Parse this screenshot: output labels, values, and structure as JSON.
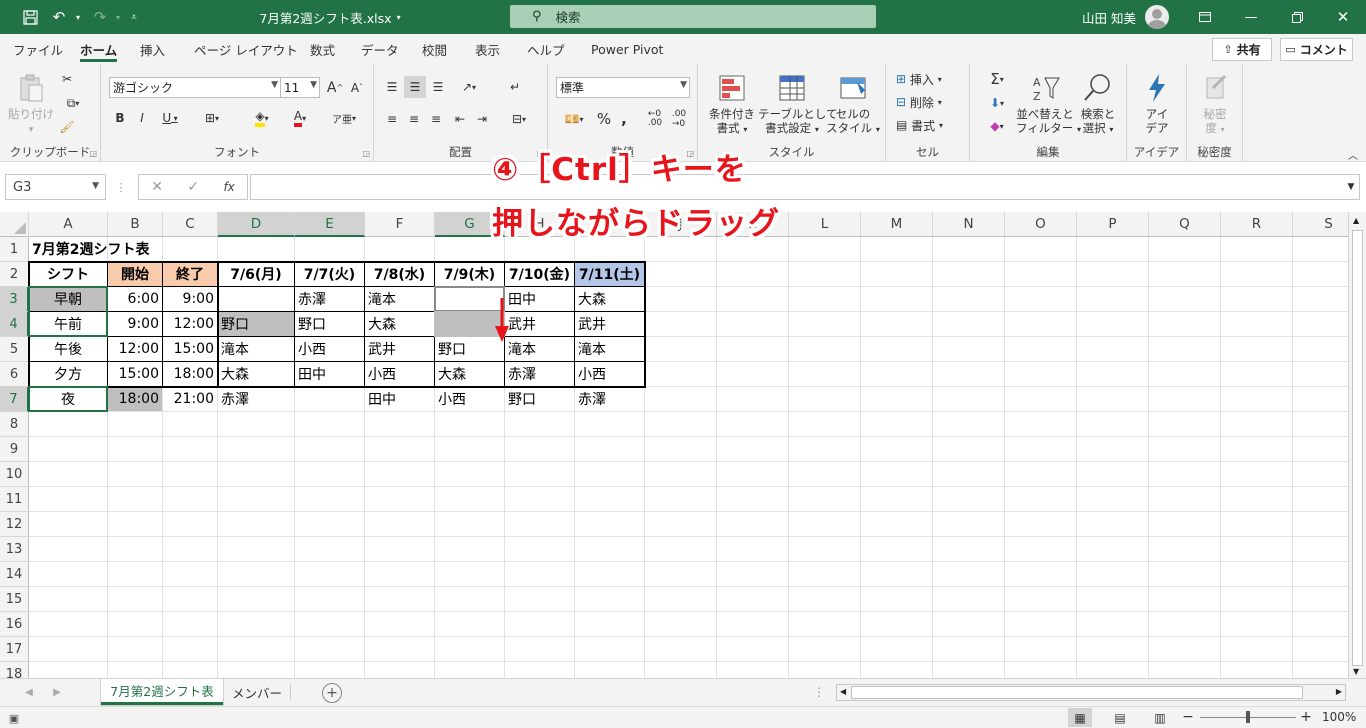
{
  "titlebar": {
    "filename": "7月第2週シフト表.xlsx",
    "search_placeholder": "検索",
    "user_name": "山田 知美",
    "icons": [
      "save-icon",
      "undo-icon",
      "redo-icon",
      "customize-icon",
      "ribbon-display-icon",
      "minimize-icon",
      "restore-icon",
      "close-icon"
    ]
  },
  "menu": {
    "tabs": [
      "ファイル",
      "ホーム",
      "挿入",
      "ページ レイアウト",
      "数式",
      "データ",
      "校閲",
      "表示",
      "ヘルプ",
      "Power Pivot"
    ],
    "active_tab": "ホーム",
    "share_label": "共有",
    "comment_label": "コメント"
  },
  "ribbon": {
    "clipboard": {
      "label": "クリップボード",
      "paste": "貼り付け"
    },
    "font": {
      "label": "フォント",
      "font_name": "游ゴシック",
      "font_size": "11"
    },
    "alignment": {
      "label": "配置"
    },
    "number": {
      "label": "数値",
      "format": "標準"
    },
    "styles": {
      "label": "スタイル",
      "cond1": "条件付き",
      "cond2": "書式",
      "table1": "テーブルとして",
      "table2": "書式設定",
      "cell1": "セルの",
      "cell2": "スタイル"
    },
    "cells": {
      "label": "セル",
      "insert": "挿入",
      "delete": "削除",
      "format": "書式"
    },
    "editing": {
      "label": "編集",
      "sort1": "並べ替えと",
      "sort2": "フィルター",
      "find1": "検索と",
      "find2": "選択"
    },
    "ideas": {
      "label": "アイデア",
      "b1": "アイ",
      "b2": "デア"
    },
    "sensitivity": {
      "label": "秘密度",
      "b1": "秘密",
      "b2": "度"
    }
  },
  "formula_bar": {
    "name_box": "G3",
    "fx": "fx",
    "formula": ""
  },
  "sheet": {
    "columns": [
      "A",
      "B",
      "C",
      "D",
      "E",
      "F",
      "G",
      "H",
      "I",
      "J",
      "K",
      "L",
      "M",
      "N",
      "O",
      "P",
      "Q",
      "R",
      "S"
    ],
    "rows": [
      "1",
      "2",
      "3",
      "4",
      "5",
      "6",
      "7",
      "8",
      "9",
      "10",
      "11",
      "12",
      "13",
      "14",
      "15",
      "16",
      "17",
      "18"
    ],
    "title": "7月第2週シフト表",
    "header": [
      "シフト",
      "開始",
      "終了",
      "7/6(月)",
      "7/7(火)",
      "7/8(水)",
      "7/9(木)",
      "7/10(金)",
      "7/11(土)"
    ],
    "body": [
      [
        "早朝",
        "6:00",
        "9:00",
        "",
        "赤澤",
        "滝本",
        "",
        "田中",
        "大森"
      ],
      [
        "午前",
        "9:00",
        "12:00",
        "野口",
        "野口",
        "大森",
        "",
        "武井",
        "武井"
      ],
      [
        "午後",
        "12:00",
        "15:00",
        "滝本",
        "小西",
        "武井",
        "野口",
        "滝本",
        "滝本"
      ],
      [
        "夕方",
        "15:00",
        "18:00",
        "大森",
        "田中",
        "小西",
        "大森",
        "赤澤",
        "小西"
      ],
      [
        "夜",
        "18:00",
        "21:00",
        "赤澤",
        "",
        "田中",
        "小西",
        "野口",
        "赤澤"
      ]
    ],
    "colors": {
      "accent": "#217346",
      "start_end_header": "#f8cbad",
      "saturday_header": "#b4c6e7",
      "gray_cell": "#bfbfbf"
    }
  },
  "annotation": {
    "line1": "④［Ctrl］キーを",
    "line2": "押しながらドラッグ",
    "color": "#e8141b"
  },
  "sheet_tabs": {
    "tabs": [
      "7月第2週シフト表",
      "メンバー"
    ],
    "active": "7月第2週シフト表"
  },
  "status": {
    "zoom": "100%"
  }
}
